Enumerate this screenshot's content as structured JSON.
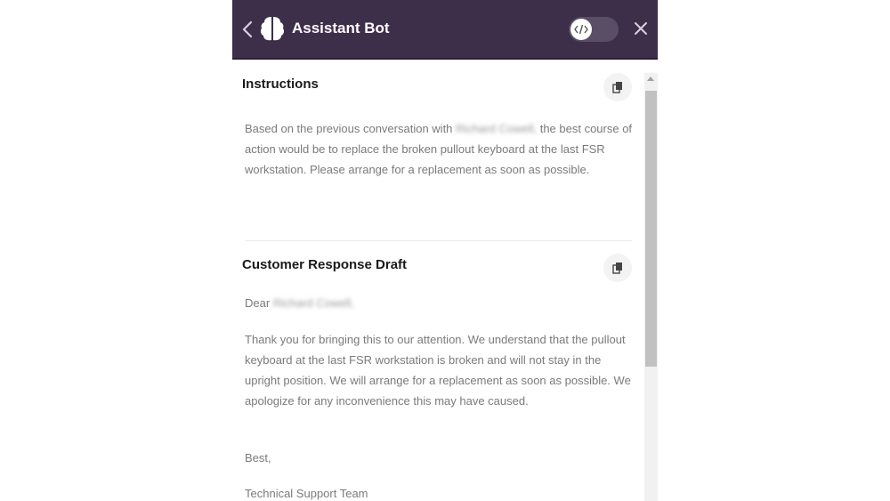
{
  "header": {
    "title": "Assistant Bot",
    "icons": {
      "back": "chevron-left-icon",
      "logo": "brain-icon",
      "toggle": "code-icon",
      "close": "close-icon"
    },
    "toggle_on": false,
    "bg_color": "#3d2e4a"
  },
  "instructions": {
    "title": "Instructions",
    "text_before_name": "Based on the previous conversation with",
    "redacted_name": "Richard Cowell,",
    "text_after_name": " the best course of action would be to replace the broken pullout keyboard at the last FSR workstation. Please arrange for a replacement as soon as possible."
  },
  "draft": {
    "title": "Customer Response Draft",
    "greeting_prefix": "Dear",
    "redacted_name": "Richard Cowell,",
    "body": "Thank you for bringing this to our attention. We understand that the pullout keyboard at the last FSR workstation is broken and will not stay in the upright position. We will arrange for a replacement as soon as possible. We apologize for any inconvenience this may have caused.",
    "signoff": "Best,",
    "signature": "Technical Support Team"
  }
}
